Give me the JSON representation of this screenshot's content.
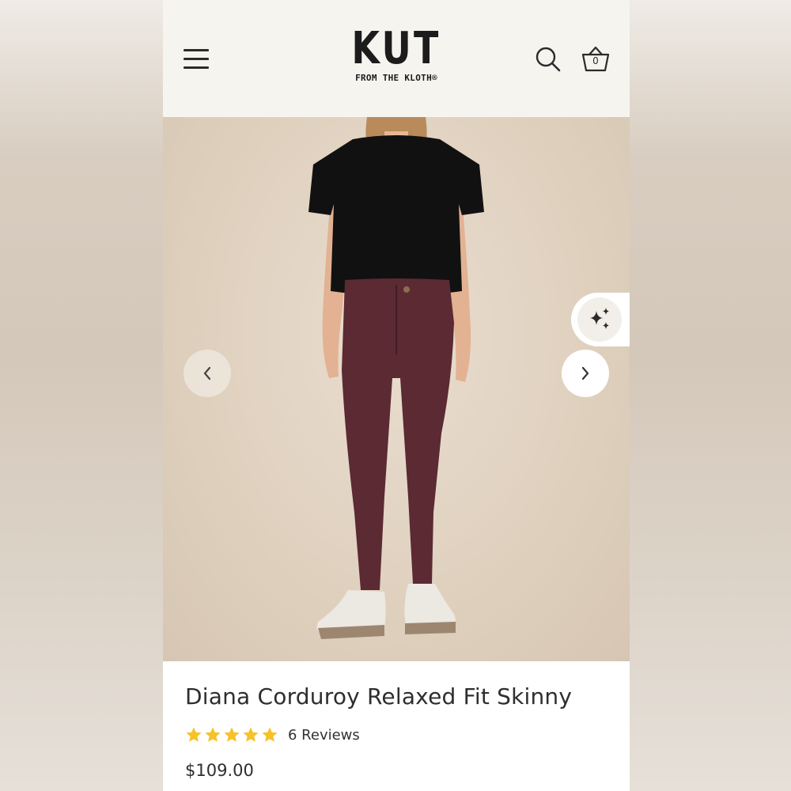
{
  "header": {
    "logo_main": "KUT",
    "logo_sub": "FROM THE KLOTH®",
    "cart_count": "0",
    "icons": [
      "menu-icon",
      "search-icon",
      "cart-basket-icon"
    ]
  },
  "gallery": {
    "icons": [
      "chevron-left-icon",
      "chevron-right-icon",
      "sparkles-icon"
    ],
    "image_description_visible": false
  },
  "product": {
    "title": "Diana Corduroy Relaxed Fit Skinny",
    "rating": 5,
    "reviews_label": "6 Reviews",
    "price": "$109.00"
  },
  "colors": {
    "star": "#f6c22a",
    "header_bg": "#f6f4ef",
    "pants": "#5b2a33",
    "shirt": "#111111"
  }
}
